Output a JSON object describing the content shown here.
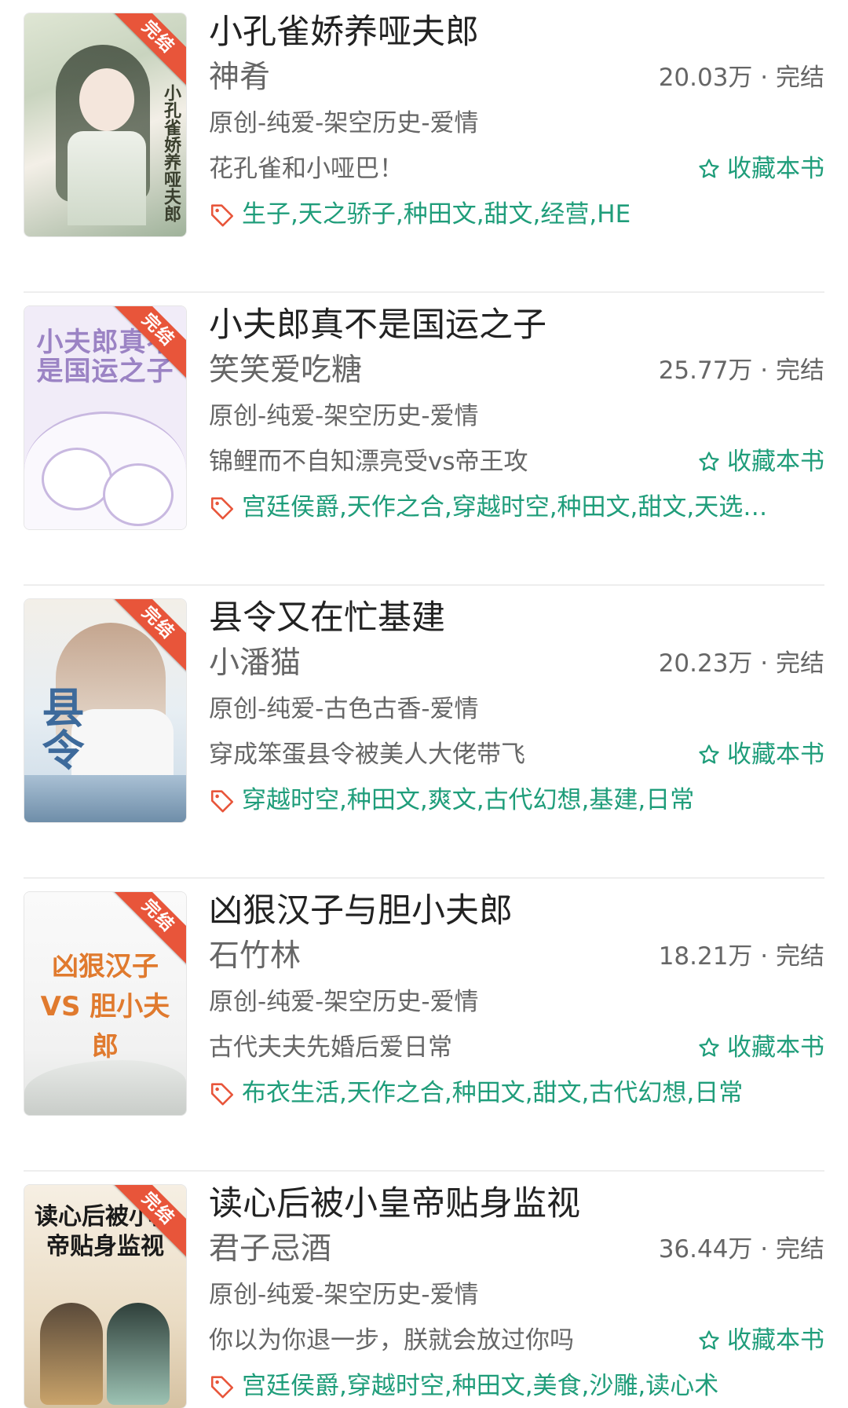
{
  "colors": {
    "accent": "#1f9d7a",
    "ribbon": "#e8553a",
    "tag_icon": "#e8553a"
  },
  "fav_icon": "star-outline-icon",
  "tag_icon": "price-tag-icon",
  "books": [
    {
      "ribbon": "完结",
      "cover_text": "小孔雀娇养哑夫郎",
      "title": "小孔雀娇养哑夫郎",
      "author": "神肴",
      "meta": "20.03万 · 完结",
      "genre": "原创-纯爱-架空历史-爱情",
      "desc": "花孔雀和小哑巴！",
      "fav": "收藏本书",
      "tags": "生子,天之骄子,种田文,甜文,经营,HE"
    },
    {
      "ribbon": "完结",
      "cover_text": "小夫郎真不是国运之子",
      "title": "小夫郎真不是国运之子",
      "author": "笑笑爱吃糖",
      "meta": "25.77万 · 完结",
      "genre": "原创-纯爱-架空历史-爱情",
      "desc": "锦鲤而不自知漂亮受vs帝王攻",
      "fav": "收藏本书",
      "tags": "宫廷侯爵,天作之合,穿越时空,种田文,甜文,天选…"
    },
    {
      "ribbon": "完结",
      "cover_text": "县令",
      "title": "县令又在忙基建",
      "author": "小潘猫",
      "meta": "20.23万 · 完结",
      "genre": "原创-纯爱-古色古香-爱情",
      "desc": "穿成笨蛋县令被美人大佬带飞",
      "fav": "收藏本书",
      "tags": "穿越时空,种田文,爽文,古代幻想,基建,日常"
    },
    {
      "ribbon": "完结",
      "cover_text": "凶狠汉子 VS 胆小夫郎",
      "title": "凶狠汉子与胆小夫郎",
      "author": "石竹林",
      "meta": "18.21万 · 完结",
      "genre": "原创-纯爱-架空历史-爱情",
      "desc": "古代夫夫先婚后爱日常",
      "fav": "收藏本书",
      "tags": "布衣生活,天作之合,种田文,甜文,古代幻想,日常"
    },
    {
      "ribbon": "完结",
      "cover_text": "读心后被小皇帝贴身监视",
      "title": "读心后被小皇帝贴身监视",
      "author": "君子忌酒",
      "meta": "36.44万 · 完结",
      "genre": "原创-纯爱-架空历史-爱情",
      "desc": "你以为你退一步，朕就会放过你吗",
      "fav": "收藏本书",
      "tags": "宫廷侯爵,穿越时空,种田文,美食,沙雕,读心术"
    }
  ]
}
